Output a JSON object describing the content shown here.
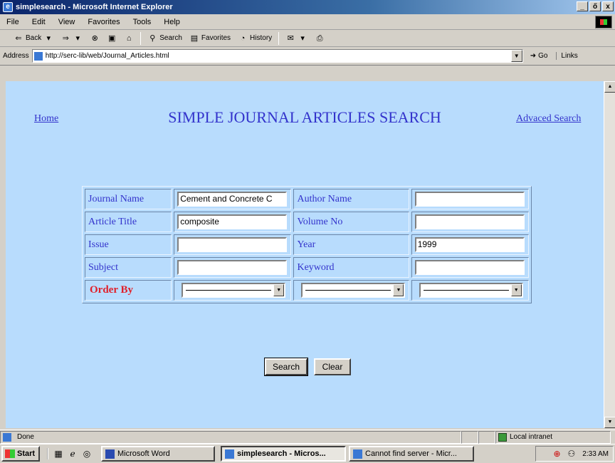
{
  "window": {
    "title": "simplesearch - Microsoft Internet Explorer",
    "controls": {
      "minimize": "_",
      "maximize": "ő",
      "close": "x"
    }
  },
  "menu": [
    "File",
    "Edit",
    "View",
    "Favorites",
    "Tools",
    "Help"
  ],
  "toolbar": {
    "back": "Back",
    "search": "Search",
    "favorites": "Favorites",
    "history": "History"
  },
  "address": {
    "label": "Address",
    "url": "http://serc-lib/web/Journal_Articles.html",
    "go": "Go",
    "links": "Links"
  },
  "page": {
    "home_link": "Home",
    "title": "SIMPLE JOURNAL ARTICLES SEARCH",
    "advanced_link": "Advaced Search"
  },
  "form": {
    "journal_name_label": "Journal Name",
    "journal_name_value": "Cement and Concrete C",
    "author_name_label": "Author Name",
    "author_name_value": "",
    "article_title_label": "Article Title",
    "article_title_value": "composite",
    "volume_no_label": "Volume No",
    "volume_no_value": "",
    "issue_label": "Issue",
    "issue_value": "",
    "year_label": "Year",
    "year_value": "1999",
    "subject_label": "Subject",
    "subject_value": "",
    "keyword_label": "Keyword",
    "keyword_value": "",
    "order_by_label": "Order By",
    "order_by_1": "",
    "order_by_2": "",
    "order_by_3": "",
    "search_button": "Search",
    "clear_button": "Clear"
  },
  "status": {
    "text": "Done",
    "zone": "Local intranet"
  },
  "taskbar": {
    "start": "Start",
    "tasks": [
      "Microsoft Word",
      "simplesearch - Micros...",
      "Cannot find server - Micr..."
    ],
    "clock": "2:33 AM"
  },
  "colors": {
    "page_background": "#b8dcfd",
    "link_text": "#3333cc",
    "order_by_text": "#e0202a"
  }
}
